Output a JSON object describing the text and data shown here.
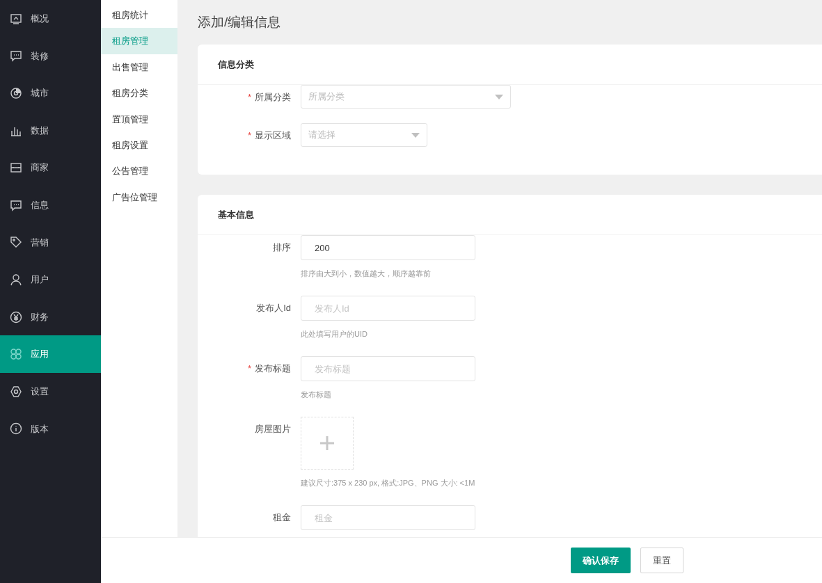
{
  "sidebar": {
    "items": [
      {
        "label": "概况",
        "selected": false
      },
      {
        "label": "装修",
        "selected": false
      },
      {
        "label": "城市",
        "selected": false
      },
      {
        "label": "数据",
        "selected": false
      },
      {
        "label": "商家",
        "selected": false
      },
      {
        "label": "信息",
        "selected": false
      },
      {
        "label": "营销",
        "selected": false
      },
      {
        "label": "用户",
        "selected": false
      },
      {
        "label": "财务",
        "selected": false
      },
      {
        "label": "应用",
        "selected": true
      },
      {
        "label": "设置",
        "selected": false
      },
      {
        "label": "版本",
        "selected": false
      }
    ]
  },
  "submenu": {
    "items": [
      {
        "label": "租房统计",
        "selected": false
      },
      {
        "label": "租房管理",
        "selected": true
      },
      {
        "label": "出售管理",
        "selected": false
      },
      {
        "label": "租房分类",
        "selected": false
      },
      {
        "label": "置顶管理",
        "selected": false
      },
      {
        "label": "租房设置",
        "selected": false
      },
      {
        "label": "公告管理",
        "selected": false
      },
      {
        "label": "广告位管理",
        "selected": false
      }
    ]
  },
  "page_title": "添加/编辑信息",
  "sections": [
    {
      "title": "信息分类",
      "fields": [
        {
          "kind": "select",
          "label": "所属分类",
          "marker": "*",
          "placeholder": "所属分类"
        },
        {
          "kind": "select",
          "label": "显示区域",
          "marker": "*",
          "placeholder": "请选择"
        }
      ]
    },
    {
      "title": "基本信息",
      "fields": [
        {
          "kind": "input",
          "label": "排序",
          "value": "200",
          "help": "排序由大到小，数值越大，顺序越靠前"
        },
        {
          "kind": "input",
          "label": "发布人Id",
          "placeholder": "发布人Id",
          "help": "此处填写用户的UID"
        },
        {
          "kind": "input",
          "label": "发布标题",
          "marker": "*",
          "placeholder": "发布标题",
          "help": "发布标题"
        },
        {
          "kind": "upload",
          "label": "房屋图片",
          "help": "建议尺寸:375 x 230 px, 格式:JPG、PNG 大小: <1M"
        },
        {
          "kind": "input",
          "label": "租金",
          "placeholder": "租金"
        }
      ]
    }
  ],
  "footer": {
    "buttons": [
      {
        "label": "确认保存",
        "kind": "primary"
      },
      {
        "label": "重置",
        "kind": "default"
      }
    ]
  }
}
